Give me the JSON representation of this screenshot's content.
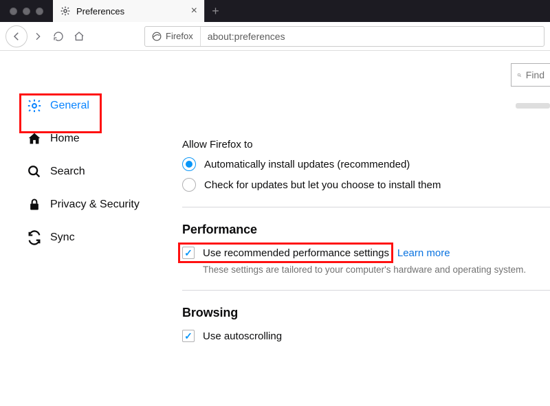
{
  "tab": {
    "title": "Preferences",
    "close": "×",
    "new": "+"
  },
  "nav": {
    "identity": "Firefox"
  },
  "url": "about:preferences",
  "find": {
    "placeholder": "Find"
  },
  "sidebar": {
    "general": "General",
    "home": "Home",
    "search": "Search",
    "privacy": "Privacy & Security",
    "sync": "Sync"
  },
  "updates": {
    "group_label": "Allow Firefox to",
    "auto": "Automatically install updates (recommended)",
    "check": "Check for updates but let you choose to install them"
  },
  "performance": {
    "heading": "Performance",
    "use_recommended": "Use recommended performance settings",
    "learn_more": "Learn more",
    "desc": "These settings are tailored to your computer's hardware and operating system."
  },
  "browsing": {
    "heading": "Browsing",
    "autoscroll": "Use autoscrolling"
  }
}
